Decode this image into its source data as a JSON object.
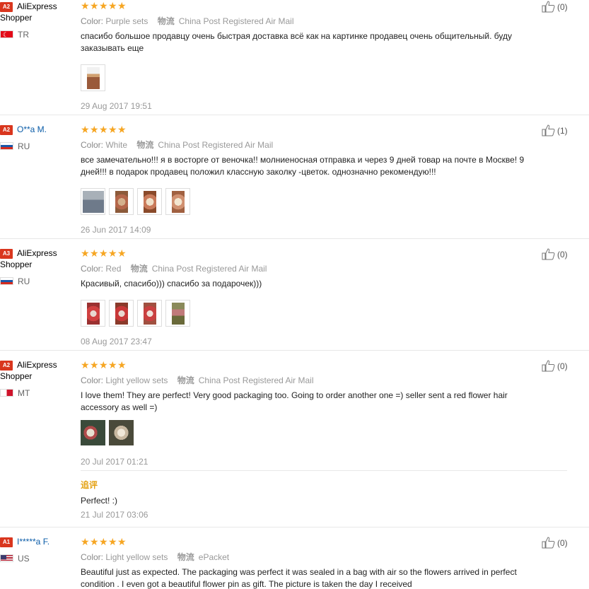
{
  "reviews": [
    {
      "badge": "A2",
      "name": "AliExpress",
      "name2": "Shopper",
      "country": "TR",
      "flag": "tr",
      "rating": 5,
      "color_label": "Color:",
      "color": "Purple sets",
      "logistics_label": "物流",
      "logistics": "China Post Registered Air Mail",
      "text": "спасибо большое продавцу очень быстрая доставка всё как на картинке продавец очень общительный. буду заказывать еще",
      "photos": [
        "photo-1"
      ],
      "date": "29 Aug 2017 19:51",
      "likes": "(0)"
    },
    {
      "badge": "A2",
      "name": "O**a M.",
      "name2": "",
      "country": "RU",
      "flag": "ru",
      "rating": 5,
      "color_label": "Color:",
      "color": "White",
      "logistics_label": "物流",
      "logistics": "China Post Registered Air Mail",
      "text": "все замечательно!!! я в восторге от веночка!! молниеносная отправка и через 9 дней товар на почте в Москве! 9 дней!!! в подарок продавец положил классную заколку -цветок. однозначно рекомендую!!!",
      "photos": [
        "photo-1",
        "photo-2",
        "photo-3",
        "photo-4"
      ],
      "date": "26 Jun 2017 14:09",
      "likes": "(1)"
    },
    {
      "badge": "A3",
      "name": "AliExpress",
      "name2": "Shopper",
      "country": "RU",
      "flag": "ru",
      "rating": 5,
      "color_label": "Color:",
      "color": "Red",
      "logistics_label": "物流",
      "logistics": "China Post Registered Air Mail",
      "text": "Красивый, спасибо))) спасибо за подарочек)))",
      "photos": [
        "photo-1",
        "photo-2",
        "photo-3",
        "photo-4"
      ],
      "date": "08 Aug 2017 23:47",
      "likes": "(0)"
    },
    {
      "badge": "A2",
      "name": "AliExpress",
      "name2": "Shopper",
      "country": "MT",
      "flag": "mt",
      "rating": 5,
      "color_label": "Color:",
      "color": "Light yellow sets",
      "logistics_label": "物流",
      "logistics": "China Post Registered Air Mail",
      "text": "I love them! They are perfect! Very good packaging too. Going to order another one =) seller sent a red flower hair accessory as well =)",
      "photos": [
        "photo-1",
        "photo-2"
      ],
      "date": "20 Jul 2017 01:21",
      "likes": "(0)",
      "followup_label": "追评",
      "followup_text": "Perfect! :)",
      "followup_date": "21 Jul 2017 03:06"
    },
    {
      "badge": "A1",
      "name": "I*****a F.",
      "name2": "",
      "country": "US",
      "flag": "us",
      "rating": 5,
      "color_label": "Color:",
      "color": "Light yellow sets",
      "logistics_label": "物流",
      "logistics": "ePacket",
      "text": "Beautiful just as expected. The packaging was perfect it was sealed in a bag with air so the flowers arrived in perfect condition . I even got a beautiful flower pin as gift. The picture is taken the day I received",
      "photos": [],
      "date": "",
      "likes": "(0)"
    }
  ],
  "colors": {
    "star": "#f6a623",
    "badge": "#d9361e",
    "link_name": "#0a5ca8",
    "followup": "#e4a112",
    "photo_palette": [
      "#c98a6a",
      "#b44a3a",
      "#8c6a4a",
      "#d4b08c",
      "#6e7a8a"
    ]
  }
}
